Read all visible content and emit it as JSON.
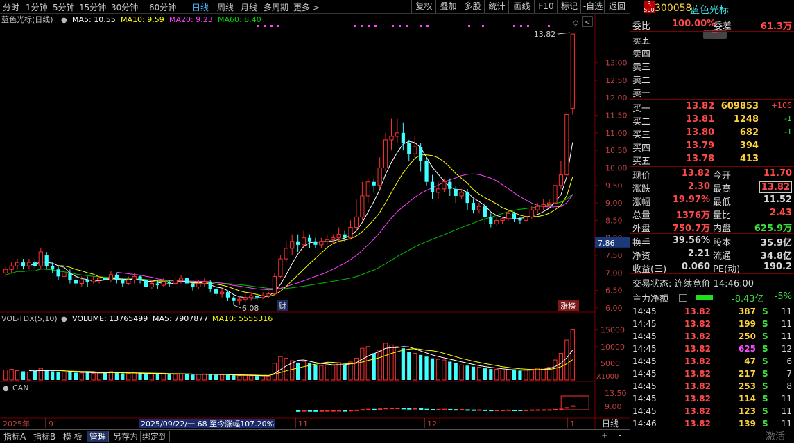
{
  "toolbar": {
    "periods": [
      "分时",
      "1分钟",
      "5分钟",
      "15分钟",
      "30分钟",
      "60分钟",
      "日线",
      "周线",
      "月线",
      "多周期",
      "更多 >"
    ],
    "active_period": "日线",
    "buttons": [
      "复权",
      "叠加",
      "多股",
      "统计",
      "画线",
      "F10",
      "标记",
      "-自选",
      "返回"
    ]
  },
  "main_chart": {
    "title": "蓝色光标(日线)",
    "ma_labels": [
      {
        "text": "MA5: 10.55",
        "color": "#ffffff"
      },
      {
        "text": "MA10: 9.59",
        "color": "#ffff00"
      },
      {
        "text": "MA20: 9.23",
        "color": "#ff40ff"
      },
      {
        "text": "MA60: 8.40",
        "color": "#00d000"
      }
    ],
    "high_label": "13.82",
    "low_label": "6.08",
    "price_axis": [
      "13.00",
      "12.50",
      "12.00",
      "11.50",
      "11.00",
      "10.50",
      "10.00",
      "9.50",
      "9.00",
      "8.50",
      "8.00",
      "7.50",
      "7.00",
      "6.50",
      "6.00"
    ],
    "current_marker": "7.86",
    "badge_cai": "财",
    "badge_zhangting": "涨榜"
  },
  "volume_chart": {
    "title": "VOL-TDX(5,10)",
    "volume": "VOLUME: 13765499",
    "ma5": "MA5: 7907877",
    "ma10": "MA10: 5555316",
    "axis": [
      "15000",
      "10000",
      "5000"
    ],
    "unit": "X1000"
  },
  "can_chart": {
    "title": "CAN",
    "axis": [
      "13.50",
      "9.00"
    ]
  },
  "date_axis": {
    "year": "2025年",
    "ticks": [
      "9",
      "11",
      "12",
      "1"
    ],
    "range_note": "2025/09/22/一 68 至今涨幅107.20%",
    "period_label": "日线"
  },
  "bottom_tabs": [
    "指标A",
    "指标B",
    "模 板",
    "管理",
    "另存为",
    "绑定到"
  ],
  "bottom_right": [
    "+",
    "-"
  ],
  "panel": {
    "code": "300058",
    "name": "蓝色光标",
    "tag_top": "R",
    "tag_bottom": "500",
    "weibi_label": "委比",
    "weibi_value": "100.00%",
    "weicha_label": "委差",
    "weicha_value": "61.3万",
    "sells": [
      "卖五",
      "卖四",
      "卖三",
      "卖二",
      "卖一"
    ],
    "buys": [
      {
        "label": "买一",
        "price": "13.82",
        "vol": "609853",
        "chg": "+106"
      },
      {
        "label": "买二",
        "price": "13.81",
        "vol": "1248",
        "chg": "-1"
      },
      {
        "label": "买三",
        "price": "13.80",
        "vol": "682",
        "chg": "-1"
      },
      {
        "label": "买四",
        "price": "13.79",
        "vol": "394",
        "chg": ""
      },
      {
        "label": "买五",
        "price": "13.78",
        "vol": "413",
        "chg": ""
      }
    ],
    "stats": [
      {
        "l1": "现价",
        "v1": "13.82",
        "c1": "rd",
        "l2": "今开",
        "v2": "11.70",
        "c2": "rd"
      },
      {
        "l1": "涨跌",
        "v1": "2.30",
        "c1": "rd",
        "l2": "最高",
        "v2": "13.82",
        "c2": "rd"
      },
      {
        "l1": "涨幅",
        "v1": "19.97%",
        "c1": "rd",
        "l2": "最低",
        "v2": "11.52",
        "c2": "wh"
      },
      {
        "l1": "总量",
        "v1": "1376万",
        "c1": "rd",
        "l2": "量比",
        "v2": "2.43",
        "c2": "rd"
      },
      {
        "l1": "外盘",
        "v1": "750.7万",
        "c1": "rd",
        "l2": "内盘",
        "v2": "625.9万",
        "c2": "gn"
      }
    ],
    "stats2": [
      {
        "l1": "换手",
        "v1": "39.56%",
        "l2": "股本",
        "v2": "35.9亿"
      },
      {
        "l1": "净资",
        "v1": "2.21",
        "l2": "流通",
        "v2": "34.8亿"
      },
      {
        "l1": "收益(三)",
        "v1": "0.060",
        "l2": "PE(动)",
        "v2": "190.2"
      }
    ],
    "trade_status": "交易状态: 连续竞价 14:46:00",
    "main_flow_label": "主力净额",
    "main_flow_value": "-8.43亿",
    "main_flow_pct": "-5%",
    "ticks": [
      {
        "t": "14:45",
        "p": "13.82",
        "v": "387",
        "vc": "yl",
        "d": "S",
        "n": "11"
      },
      {
        "t": "14:45",
        "p": "13.82",
        "v": "199",
        "vc": "yl",
        "d": "S",
        "n": "11"
      },
      {
        "t": "14:45",
        "p": "13.82",
        "v": "250",
        "vc": "yl",
        "d": "S",
        "n": "11"
      },
      {
        "t": "14:45",
        "p": "13.82",
        "v": "625",
        "vc": "mg",
        "d": "S",
        "n": "12"
      },
      {
        "t": "14:45",
        "p": "13.82",
        "v": "47",
        "vc": "yl",
        "d": "S",
        "n": "6"
      },
      {
        "t": "14:45",
        "p": "13.82",
        "v": "217",
        "vc": "yl",
        "d": "S",
        "n": "7"
      },
      {
        "t": "14:45",
        "p": "13.82",
        "v": "253",
        "vc": "yl",
        "d": "S",
        "n": "8"
      },
      {
        "t": "14:45",
        "p": "13.82",
        "v": "114",
        "vc": "yl",
        "d": "S",
        "n": "11"
      },
      {
        "t": "14:45",
        "p": "13.82",
        "v": "123",
        "vc": "yl",
        "d": "S",
        "n": "11"
      },
      {
        "t": "14:46",
        "p": "13.82",
        "v": "139",
        "vc": "yl",
        "d": "S",
        "n": "11"
      }
    ],
    "watermark": "激活"
  },
  "chart_data": {
    "type": "candlestick",
    "price_range": [
      5.9,
      14.0
    ],
    "volume_max": 17000,
    "candles": [
      [
        7.0,
        7.1,
        6.9,
        7.2
      ],
      [
        7.1,
        7.2,
        7.0,
        7.3
      ],
      [
        7.2,
        7.3,
        7.1,
        7.4
      ],
      [
        7.3,
        7.2,
        7.1,
        7.4
      ],
      [
        7.2,
        7.3,
        7.1,
        7.4
      ],
      [
        7.3,
        7.2,
        7.1,
        7.4
      ],
      [
        7.2,
        7.6,
        7.1,
        7.7
      ],
      [
        7.5,
        7.2,
        7.1,
        7.6
      ],
      [
        7.2,
        7.1,
        7.0,
        7.3
      ],
      [
        7.1,
        6.9,
        6.8,
        7.2
      ],
      [
        6.9,
        7.0,
        6.8,
        7.1
      ],
      [
        7.0,
        6.8,
        6.7,
        7.1
      ],
      [
        6.8,
        6.7,
        6.6,
        6.9
      ],
      [
        6.7,
        6.8,
        6.6,
        6.9
      ],
      [
        6.8,
        6.75,
        6.6,
        6.9
      ],
      [
        6.75,
        6.8,
        6.7,
        6.9
      ],
      [
        6.8,
        6.85,
        6.7,
        6.9
      ],
      [
        6.85,
        6.8,
        6.7,
        6.95
      ],
      [
        6.8,
        6.95,
        6.75,
        7.05
      ],
      [
        6.95,
        6.8,
        6.7,
        7.0
      ],
      [
        6.8,
        6.7,
        6.6,
        6.85
      ],
      [
        6.7,
        6.8,
        6.65,
        6.9
      ],
      [
        6.8,
        6.9,
        6.7,
        7.0
      ],
      [
        6.9,
        6.8,
        6.7,
        6.95
      ],
      [
        6.8,
        6.6,
        6.5,
        6.85
      ],
      [
        6.6,
        6.7,
        6.55,
        6.8
      ],
      [
        6.7,
        6.65,
        6.55,
        6.8
      ],
      [
        6.65,
        6.75,
        6.6,
        6.85
      ],
      [
        6.75,
        6.7,
        6.6,
        6.8
      ],
      [
        6.7,
        6.8,
        6.65,
        6.9
      ],
      [
        6.8,
        6.85,
        6.7,
        6.95
      ],
      [
        6.85,
        6.7,
        6.6,
        6.9
      ],
      [
        6.7,
        6.6,
        6.5,
        6.75
      ],
      [
        6.6,
        6.7,
        6.55,
        6.8
      ],
      [
        6.7,
        6.75,
        6.6,
        6.85
      ],
      [
        6.75,
        6.55,
        6.45,
        6.8
      ],
      [
        6.55,
        6.4,
        6.35,
        6.6
      ],
      [
        6.4,
        6.45,
        6.3,
        6.55
      ],
      [
        6.45,
        6.3,
        6.2,
        6.5
      ],
      [
        6.3,
        6.2,
        6.08,
        6.35
      ],
      [
        6.2,
        6.25,
        6.1,
        6.35
      ],
      [
        6.25,
        6.3,
        6.15,
        6.4
      ],
      [
        6.3,
        6.35,
        6.2,
        6.45
      ],
      [
        6.35,
        6.3,
        6.2,
        6.4
      ],
      [
        6.3,
        6.35,
        6.25,
        6.45
      ],
      [
        6.35,
        6.4,
        6.3,
        6.45
      ],
      [
        6.4,
        6.9,
        6.35,
        7.0
      ],
      [
        6.9,
        7.4,
        6.85,
        7.5
      ],
      [
        7.4,
        7.7,
        7.3,
        7.9
      ],
      [
        7.7,
        7.9,
        7.5,
        8.1
      ],
      [
        7.9,
        7.8,
        7.6,
        8.1
      ],
      [
        7.8,
        8.0,
        7.7,
        8.2
      ],
      [
        8.0,
        7.9,
        7.7,
        8.1
      ],
      [
        7.9,
        7.8,
        7.7,
        8.0
      ],
      [
        7.8,
        7.9,
        7.7,
        8.0
      ],
      [
        7.9,
        7.95,
        7.8,
        8.1
      ],
      [
        7.95,
        8.0,
        7.85,
        8.1
      ],
      [
        8.0,
        8.1,
        7.9,
        8.3
      ],
      [
        8.1,
        8.0,
        7.9,
        8.2
      ],
      [
        8.0,
        8.3,
        7.95,
        8.5
      ],
      [
        8.3,
        8.6,
        8.2,
        9.1
      ],
      [
        8.6,
        9.2,
        8.5,
        9.6
      ],
      [
        9.2,
        9.6,
        9.0,
        9.7
      ],
      [
        9.6,
        9.5,
        9.3,
        9.7
      ],
      [
        9.5,
        10.0,
        9.4,
        10.3
      ],
      [
        10.0,
        10.8,
        9.9,
        11.0
      ],
      [
        10.8,
        10.9,
        10.5,
        11.4
      ],
      [
        10.9,
        11.0,
        10.7,
        11.4
      ],
      [
        11.0,
        10.7,
        10.5,
        11.3
      ],
      [
        10.7,
        10.4,
        10.2,
        10.8
      ],
      [
        10.4,
        10.6,
        10.3,
        10.9
      ],
      [
        10.6,
        10.2,
        9.9,
        10.7
      ],
      [
        10.2,
        9.6,
        9.5,
        10.3
      ],
      [
        9.6,
        9.3,
        9.1,
        9.8
      ],
      [
        9.3,
        9.4,
        9.1,
        9.6
      ],
      [
        9.4,
        9.6,
        9.3,
        9.7
      ],
      [
        9.6,
        9.4,
        9.2,
        9.7
      ],
      [
        9.4,
        9.2,
        9.0,
        9.5
      ],
      [
        9.2,
        9.3,
        9.1,
        9.4
      ],
      [
        9.3,
        9.0,
        8.8,
        9.4
      ],
      [
        9.0,
        8.8,
        8.7,
        9.1
      ],
      [
        8.8,
        8.9,
        8.7,
        9.0
      ],
      [
        8.9,
        8.6,
        8.4,
        9.0
      ],
      [
        8.6,
        8.4,
        8.3,
        8.7
      ],
      [
        8.4,
        8.5,
        8.35,
        8.6
      ],
      [
        8.5,
        8.55,
        8.4,
        8.6
      ],
      [
        8.55,
        8.7,
        8.5,
        8.8
      ],
      [
        8.7,
        8.55,
        8.45,
        8.75
      ],
      [
        8.55,
        8.5,
        8.4,
        8.6
      ],
      [
        8.5,
        8.6,
        8.45,
        8.7
      ],
      [
        8.6,
        8.8,
        8.55,
        8.9
      ],
      [
        8.8,
        8.9,
        8.7,
        9.0
      ],
      [
        8.9,
        8.95,
        8.8,
        9.1
      ],
      [
        8.95,
        9.0,
        8.85,
        9.1
      ],
      [
        9.0,
        9.5,
        8.95,
        10.1
      ],
      [
        9.5,
        9.8,
        9.4,
        10.2
      ],
      [
        9.8,
        11.52,
        9.7,
        11.6
      ],
      [
        11.7,
        13.82,
        11.52,
        13.82
      ]
    ],
    "volumes": [
      3000,
      3200,
      2800,
      2600,
      2400,
      2700,
      3500,
      2900,
      2600,
      2500,
      2400,
      2300,
      2200,
      2100,
      2300,
      2000,
      2100,
      2200,
      2500,
      2100,
      2000,
      1900,
      2100,
      2000,
      1800,
      1900,
      1700,
      1800,
      1900,
      1700,
      1800,
      1700,
      1600,
      1700,
      1800,
      1600,
      1500,
      1600,
      1500,
      1400,
      1300,
      1400,
      1300,
      1200,
      1300,
      1200,
      5000,
      7000,
      6500,
      5800,
      5200,
      5600,
      5000,
      4500,
      4300,
      4500,
      4400,
      5200,
      4600,
      5400,
      6500,
      9500,
      10000,
      8000,
      9000,
      11000,
      10500,
      10000,
      9500,
      8500,
      8000,
      7500,
      7000,
      6500,
      6200,
      6000,
      5500,
      5000,
      4500,
      4300,
      4000,
      3800,
      3500,
      3300,
      3200,
      3000,
      3000,
      2900,
      2800,
      3000,
      3200,
      3500,
      3600,
      3800,
      6000,
      8000,
      12000,
      15000
    ],
    "ma5": [],
    "ma10": [],
    "ma20": [],
    "ma60": []
  }
}
